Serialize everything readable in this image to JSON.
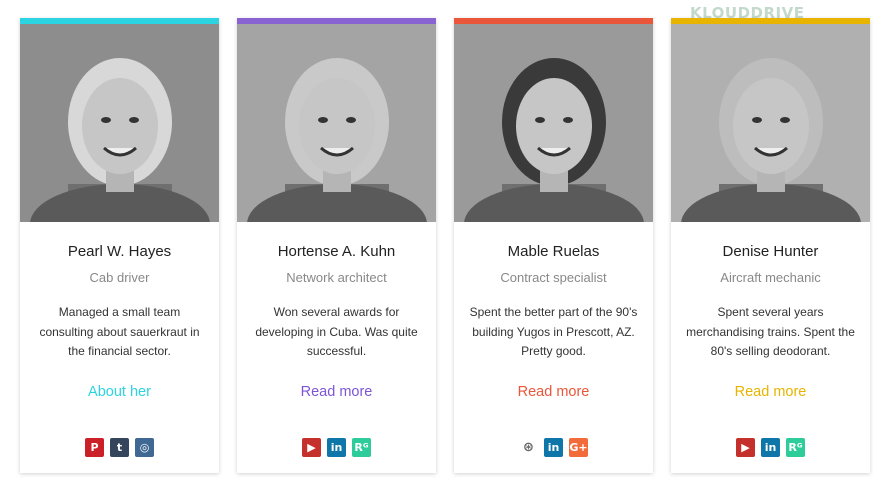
{
  "watermark": "KLOUDDRIVE",
  "cards": [
    {
      "name": "Pearl W. Hayes",
      "role": "Cab driver",
      "bio": "Managed a small team consulting about sauerkraut in the financial sector.",
      "link": "About her",
      "accent": "#2bd4e0",
      "link_color": "#2bd4e0",
      "socials": [
        {
          "icon": "pinterest-icon",
          "glyph": "P",
          "color": "#cb2027"
        },
        {
          "icon": "tumblr-icon",
          "glyph": "t",
          "color": "#35465c"
        },
        {
          "icon": "instagram-icon",
          "glyph": "◎",
          "color": "#3f6892"
        }
      ]
    },
    {
      "name": "Hortense A. Kuhn",
      "role": "Network architect",
      "bio": "Won several awards for developing in Cuba. Was quite successful.",
      "link": "Read more",
      "accent": "#8a63d2",
      "link_color": "#7d55d6",
      "socials": [
        {
          "icon": "youtube-icon",
          "glyph": "▶",
          "color": "#c4302b"
        },
        {
          "icon": "linkedin-icon",
          "glyph": "in",
          "color": "#0e76a8"
        },
        {
          "icon": "researchgate-icon",
          "glyph": "Rᴳ",
          "color": "#2ecc9a"
        }
      ]
    },
    {
      "name": "Mable Ruelas",
      "role": "Contract specialist",
      "bio": "Spent the better part of the 90's building Yugos in Prescott, AZ. Pretty good.",
      "link": "Read more",
      "accent": "#e9563a",
      "link_color": "#e9563a",
      "socials": [
        {
          "icon": "github-icon",
          "glyph": "⊛",
          "color": "transparent"
        },
        {
          "icon": "linkedin-icon",
          "glyph": "in",
          "color": "#0e76a8"
        },
        {
          "icon": "google-plus-icon",
          "glyph": "G+",
          "color": "#f26b3a"
        }
      ]
    },
    {
      "name": "Denise Hunter",
      "role": "Aircraft mechanic",
      "bio": "Spent several years merchandising trains. Spent the 80's selling deodorant.",
      "link": "Read more",
      "accent": "#e8b400",
      "link_color": "#e8b400",
      "socials": [
        {
          "icon": "youtube-icon",
          "glyph": "▶",
          "color": "#c4302b"
        },
        {
          "icon": "linkedin-icon",
          "glyph": "in",
          "color": "#0e76a8"
        },
        {
          "icon": "researchgate-icon",
          "glyph": "Rᴳ",
          "color": "#2ecc9a"
        }
      ]
    }
  ]
}
